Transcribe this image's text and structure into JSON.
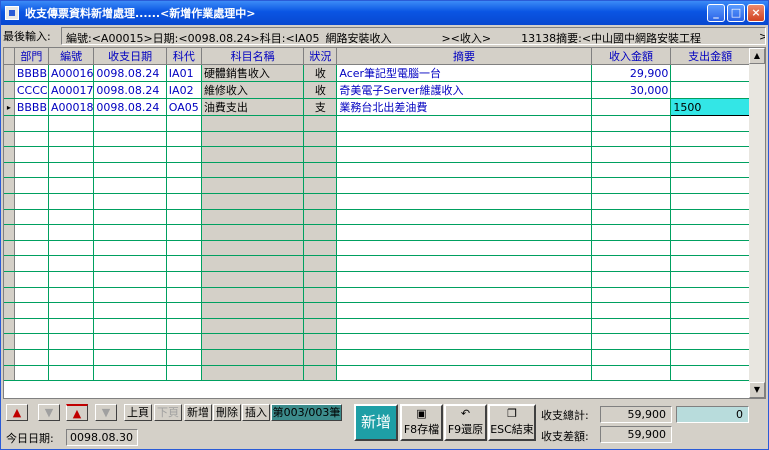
{
  "title": "收支傳票資料新增處理......<新增作業處理中>",
  "window_controls": {
    "min": "_",
    "max": "□",
    "close": "×"
  },
  "last_input": {
    "label": "最後輸入:",
    "parts": [
      "編號:<A00015>日期:<0098.08.24>科目:<IA05",
      "網路安裝收入",
      "><收入>",
      "13138摘要:<中山國中網路安裝工程",
      ">"
    ]
  },
  "columns": [
    "部門",
    "編號",
    "收支日期",
    "科代",
    "科目名稱",
    "狀況",
    "摘要",
    "收入金額",
    "支出金額"
  ],
  "rows": [
    {
      "dept": "BBBB",
      "no": "A00016",
      "date": "0098.08.24",
      "code": "IA01",
      "name": "硬體銷售收入",
      "status": "收",
      "memo": "Acer筆記型電腦一台",
      "income": "29,900",
      "expense": ""
    },
    {
      "dept": "CCCC",
      "no": "A00017",
      "date": "0098.08.24",
      "code": "IA02",
      "name": "維修收入",
      "status": "收",
      "memo": "奇美電子Server維護收入",
      "income": "30,000",
      "expense": ""
    },
    {
      "dept": "BBBB",
      "no": "A00018",
      "date": "0098.08.24",
      "code": "OA05",
      "name": "油費支出",
      "status": "支",
      "memo": "業務台北出差油費",
      "income": "",
      "expense": "1500"
    }
  ],
  "nav": {
    "first": "▲",
    "prev": "▼",
    "top": "▲",
    "bottom": "▼",
    "prev_page": "上頁",
    "next_page": "下頁",
    "add": "新增",
    "delete": "刪除",
    "insert": "插入",
    "record": "第003/003筆"
  },
  "actions": {
    "new": "新增",
    "save": "F8存檔",
    "restore": "F9還原",
    "exit": "ESC結束"
  },
  "today": {
    "label": "今日日期:",
    "value": "0098.08.30"
  },
  "totals": {
    "total_label": "收支總計:",
    "income_total": "59,900",
    "expense_total": "0",
    "diff_label": "收支差額:",
    "diff": "59,900"
  }
}
